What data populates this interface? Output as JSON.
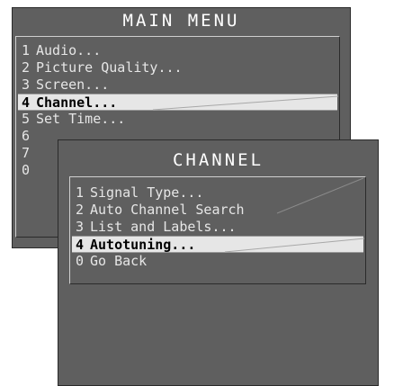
{
  "main_menu": {
    "title": "MAIN MENU",
    "items": [
      {
        "number": "1",
        "label": "Audio..."
      },
      {
        "number": "2",
        "label": "Picture Quality..."
      },
      {
        "number": "3",
        "label": "Screen..."
      },
      {
        "number": "4",
        "label": "Channel...",
        "selected": true
      },
      {
        "number": "5",
        "label": "Set Time..."
      },
      {
        "number": "6",
        "label": ""
      },
      {
        "number": "7",
        "label": ""
      },
      {
        "number": "0",
        "label": ""
      }
    ]
  },
  "channel_menu": {
    "title": "CHANNEL",
    "items": [
      {
        "number": "1",
        "label": "Signal Type..."
      },
      {
        "number": "2",
        "label": "Auto Channel Search"
      },
      {
        "number": "3",
        "label": "List and Labels..."
      },
      {
        "number": "4",
        "label": "Autotuning...",
        "selected": true
      },
      {
        "number": "0",
        "label": "Go Back"
      }
    ]
  },
  "colors": {
    "panel_bg": "#5f5f5f",
    "text": "#e6e6e6",
    "highlight_bg": "#e6e6e6",
    "highlight_text": "#000000"
  }
}
